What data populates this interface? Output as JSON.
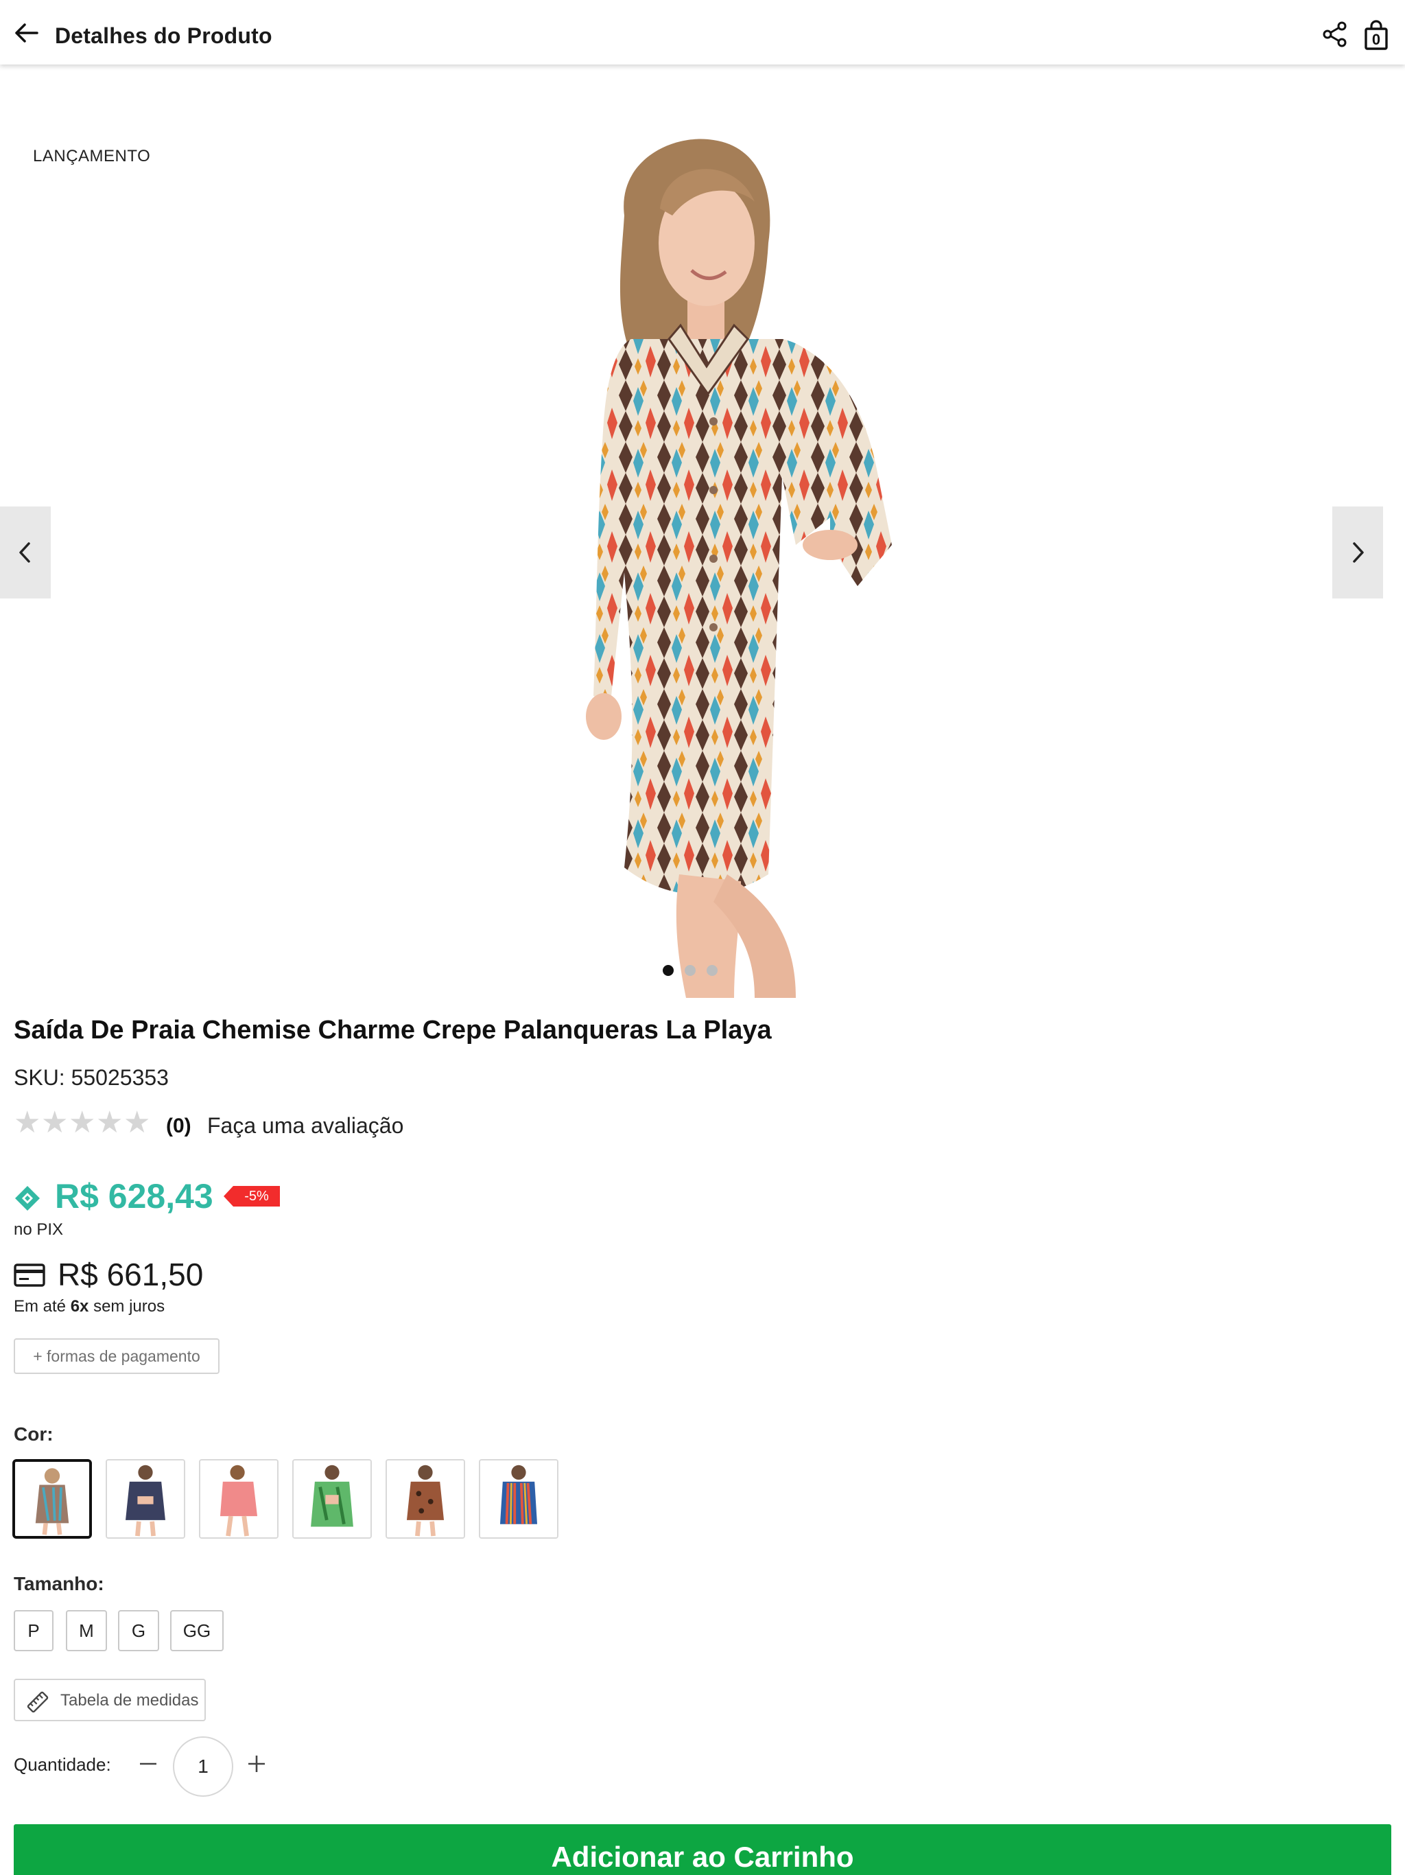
{
  "header": {
    "title": "Detalhes do Produto",
    "bag_count": "0"
  },
  "gallery": {
    "badge": "LANÇAMENTO",
    "image_count": 3,
    "active_index": 0
  },
  "product": {
    "name": "Saída De Praia Chemise Charme Crepe Palanqueras La Playa",
    "sku": "SKU: 55025353",
    "rating_value": 0,
    "rating_count": "(0)",
    "rating_link": "Faça uma avaliação"
  },
  "price": {
    "pix_price": "R$ 628,43",
    "pix_label": "no PIX",
    "discount": "-5%",
    "card_price": "R$ 661,50",
    "installments_prefix": "Em até ",
    "installments_count": "6x",
    "installments_suffix": " sem juros",
    "payment_methods_button": "+ formas de pagamento"
  },
  "colors": {
    "label": "Cor:",
    "selected_index": 0,
    "options": [
      "multicolor ikat print",
      "navy print bikini set",
      "coral pink print",
      "green tropical print",
      "brown animal print",
      "striped multicolor"
    ]
  },
  "sizes": {
    "label": "Tamanho:",
    "options": [
      "P",
      "M",
      "G",
      "GG"
    ]
  },
  "measure_table": "Tabela de medidas",
  "quantity": {
    "label": "Quantidade:",
    "value": "1"
  },
  "add_to_cart": "Adicionar ao Carrinho",
  "colors_theme": {
    "accent": "#32b9a3",
    "cta": "#0da642",
    "discount": "#f22c2c"
  }
}
